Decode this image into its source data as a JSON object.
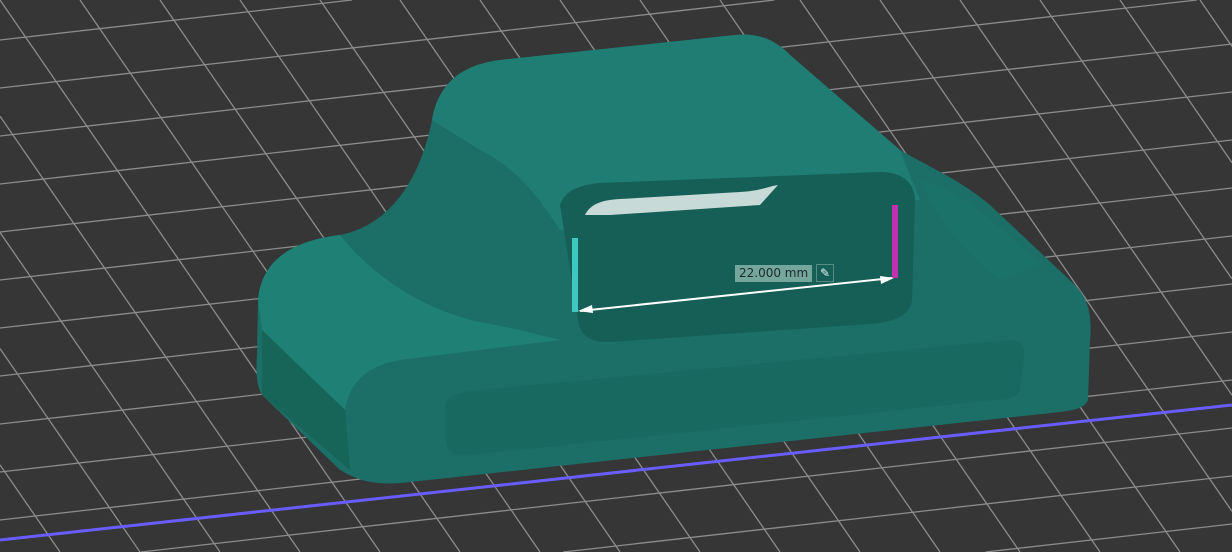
{
  "measurement": {
    "value_label": "22.000 mm",
    "edit_icon": "edit-icon"
  },
  "colors": {
    "background": "#363636",
    "grid": "#9a9a9a",
    "model": "#1d7a70",
    "axis_x": "#6a5cff",
    "point_a": "#3fc8c0",
    "point_b": "#c030b0"
  }
}
